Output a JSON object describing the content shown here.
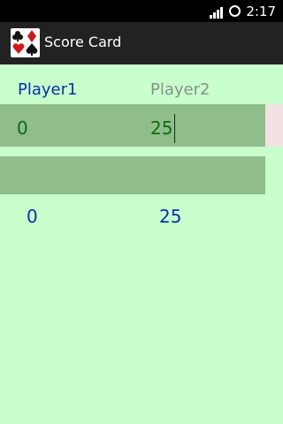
{
  "status_bar": {
    "time": "2:17",
    "icons": [
      "signal-icon",
      "sync-icon"
    ]
  },
  "action_bar": {
    "title": "Score Card",
    "icon": "card-suits-icon"
  },
  "headers": {
    "player1": "Player1",
    "player2": "Player2"
  },
  "entry_row": {
    "player1_value": "0",
    "player2_value": "25"
  },
  "totals": {
    "player1": "0",
    "player2": "25"
  },
  "colors": {
    "background": "#c8ffcc",
    "row": "#8fbe8a",
    "header_active": "#0b2fa8",
    "header_inactive": "#8a8f8a",
    "entry_text": "#0e6a16"
  }
}
